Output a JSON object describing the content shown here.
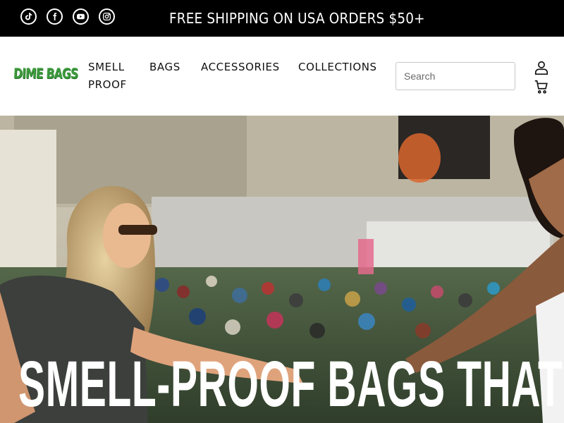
{
  "topbar": {
    "announcement": "FREE SHIPPING ON USA ORDERS $50+",
    "social": [
      {
        "name": "tiktok-icon"
      },
      {
        "name": "facebook-icon"
      },
      {
        "name": "youtube-icon"
      },
      {
        "name": "instagram-icon"
      }
    ]
  },
  "header": {
    "logo_text": "DIME BAGS",
    "nav": {
      "smell_proof": "SMELL PROOF",
      "bags": "BAGS",
      "accessories": "ACCESSORIES",
      "collections": "COLLECTIONS"
    },
    "search": {
      "placeholder": "Search",
      "value": ""
    },
    "icons": {
      "account": "account-icon",
      "cart": "cart-icon"
    }
  },
  "hero": {
    "headline": "SMELL-PROOF BAGS THAT"
  },
  "colors": {
    "topbar_bg": "#000000",
    "logo_green": "#3c9a3c",
    "text_dark": "#111111"
  }
}
